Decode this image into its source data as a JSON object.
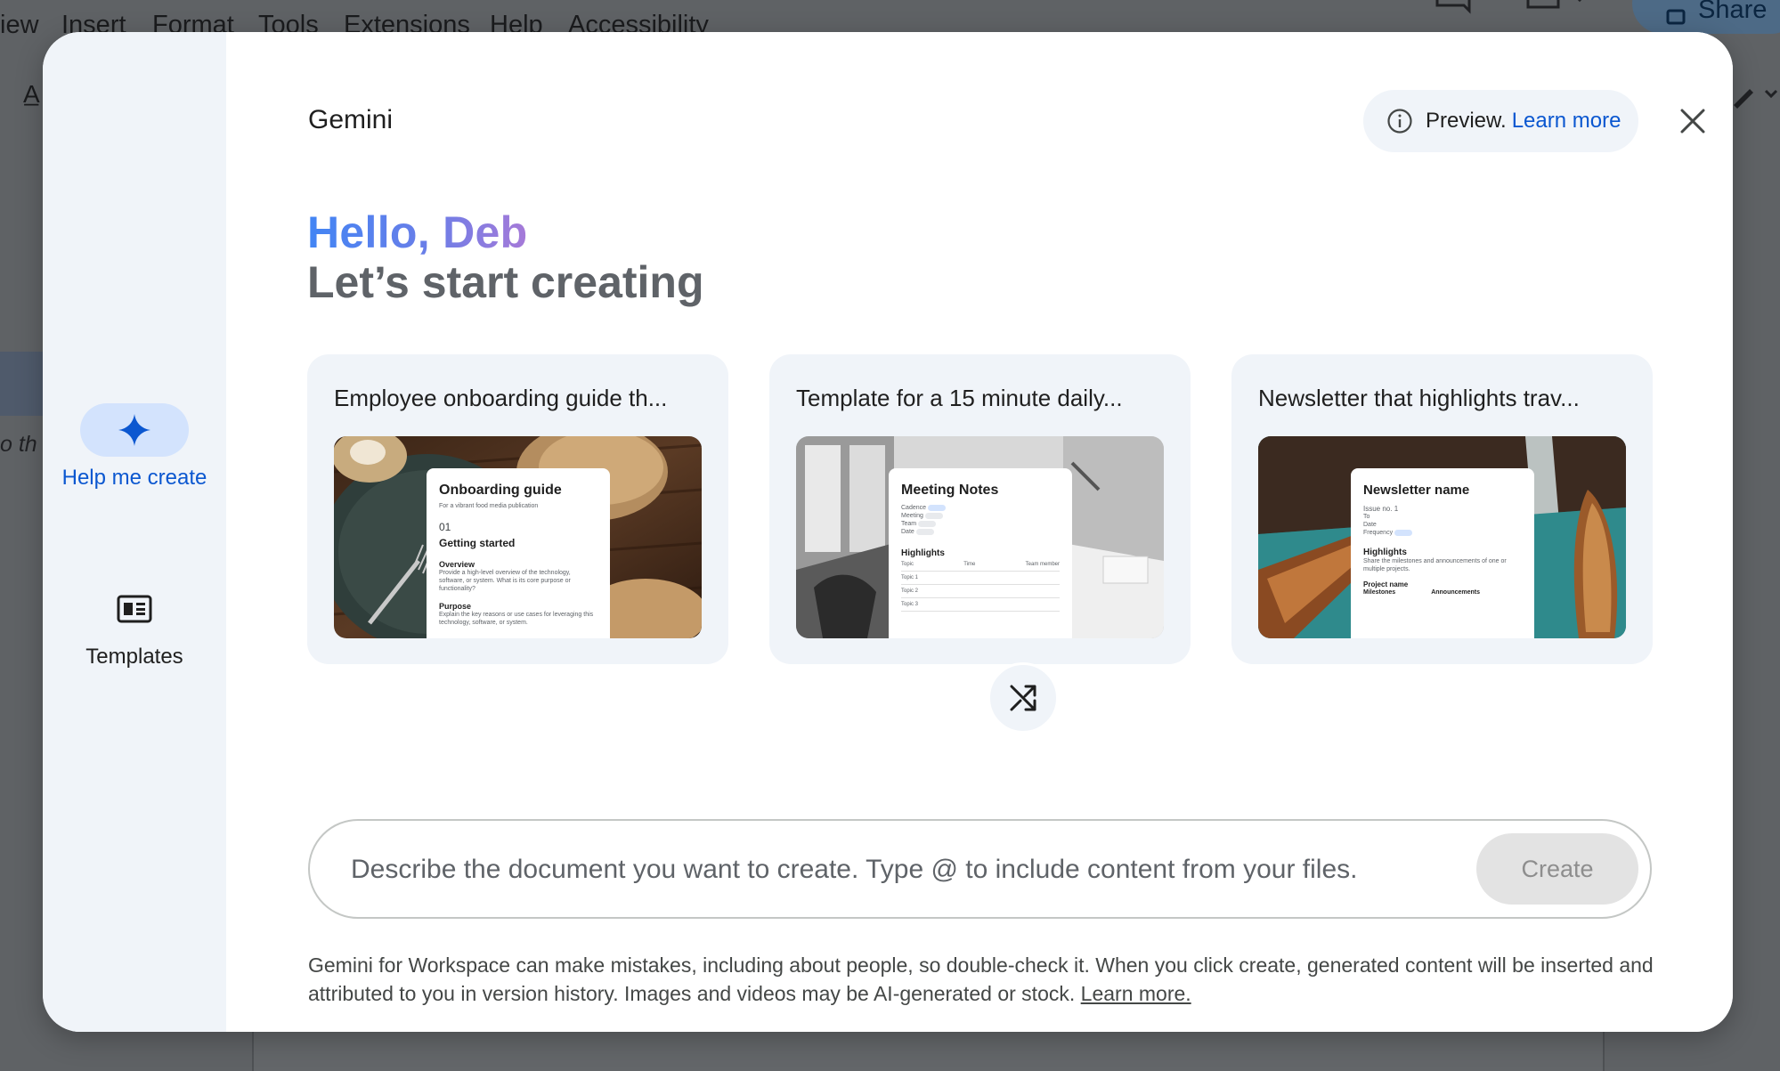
{
  "background": {
    "menu": [
      "iew",
      "Insert",
      "Format",
      "Tools",
      "Extensions",
      "Help",
      "Accessibility"
    ],
    "share_label": "Share",
    "italic_fragment": "o th"
  },
  "rail": {
    "help_me_create": "Help me create",
    "templates": "Templates"
  },
  "header": {
    "brand": "Gemini",
    "preview_text": "Preview.",
    "learn_more": "Learn more"
  },
  "greeting": {
    "hello": "Hello, Deb",
    "subtitle": "Let’s start creating"
  },
  "cards": [
    {
      "title": "Employee onboarding guide th...",
      "doc_title": "Onboarding guide",
      "doc_tagline": "For a vibrant food media publication",
      "doc_number": "01",
      "doc_section": "Getting started",
      "doc_sub1": "Overview",
      "doc_text1": "Provide a high-level overview of the technology, software, or system. What is its core purpose or functionality?",
      "doc_sub2": "Purpose",
      "doc_text2": "Explain the key reasons or use cases for leveraging this technology, software, or system."
    },
    {
      "title": "Template for a 15 minute daily...",
      "doc_title": "Meeting Notes",
      "doc_fields": [
        "Cadence",
        "Meeting",
        "Team",
        "Date"
      ],
      "doc_section": "Highlights",
      "doc_cols": [
        "Topic",
        "Time",
        "Team member"
      ],
      "doc_rows": [
        "Topic 1",
        "Topic 2",
        "Topic 3"
      ]
    },
    {
      "title": "Newsletter that highlights trav...",
      "doc_title": "Newsletter name",
      "doc_issue": "Issue no. 1",
      "doc_fields": [
        "To",
        "Date",
        "Frequency"
      ],
      "doc_section": "Highlights",
      "doc_text": "Share the milestones and announcements of one or multiple projects.",
      "doc_sub": "Project name",
      "doc_cols": [
        "Milestones",
        "Announcements"
      ]
    }
  ],
  "prompt": {
    "placeholder": "Describe the document you want to create. Type @ to include content from your files.",
    "value": "",
    "create_label": "Create"
  },
  "disclaimer": {
    "text": "Gemini for Workspace can make mistakes, including about people, so double-check it. When you click create, generated content will be inserted and attributed to you in version history. Images and videos may be AI-generated or stock. ",
    "link": "Learn more."
  },
  "colors": {
    "accent": "#0b57d0",
    "rail_bg": "#f0f4f9",
    "active_pill": "#d3e3fd",
    "greeting_gradient": [
      "#4285f4",
      "#a67ad8"
    ]
  },
  "icons": {
    "rail_create": "sparkle-icon",
    "rail_templates": "templates-icon",
    "preview": "info-icon",
    "close": "close-icon",
    "shuffle": "shuffle-icon"
  }
}
